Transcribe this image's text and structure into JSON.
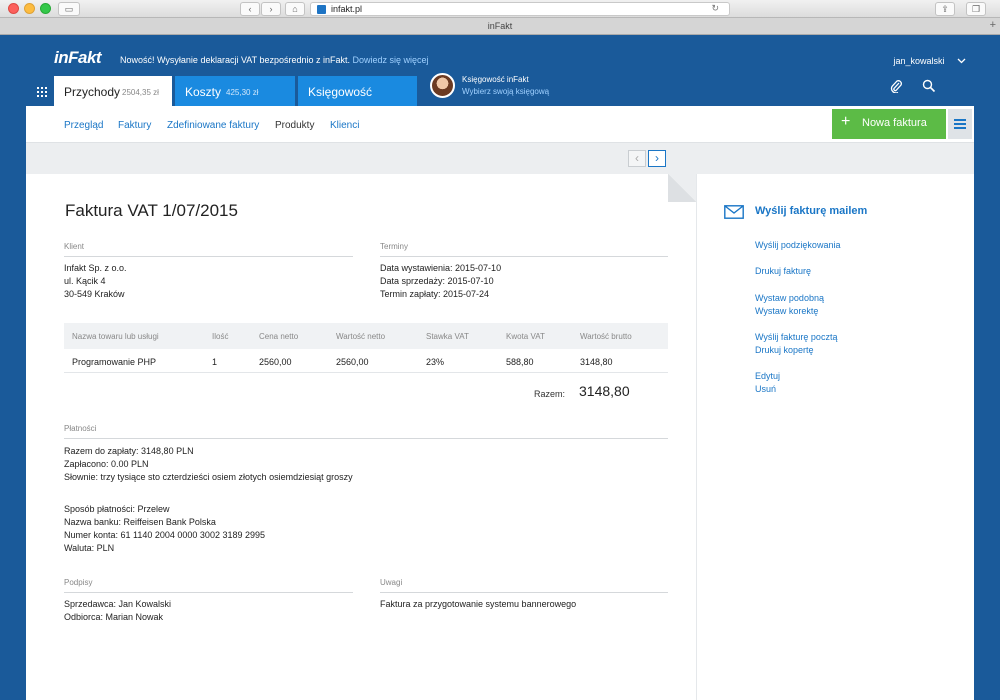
{
  "browser": {
    "url": "infakt.pl",
    "tab_title": "inFakt",
    "new_tab_glyph": "+"
  },
  "header": {
    "logo": "inFakt",
    "news_text": "Nowość! Wysyłanie deklaracji VAT bezpośrednio z inFakt.",
    "news_link": "Dowiedz się więcej",
    "username": "jan_kowalski"
  },
  "tabs": [
    {
      "label": "Przychody",
      "amount": "2504,35 zł"
    },
    {
      "label": "Koszty",
      "amount": "425,30 zł"
    },
    {
      "label": "Księgowość",
      "amount": ""
    }
  ],
  "accountant": {
    "title": "Księgowość inFakt",
    "link": "Wybierz swoją księgową"
  },
  "subnav": {
    "items": [
      "Przegląd",
      "Faktury",
      "Zdefiniowane faktury",
      "Produkty",
      "Klienci"
    ],
    "active_index": 3,
    "new_invoice": "Nowa faktura"
  },
  "invoice": {
    "title": "Faktura VAT 1/07/2015",
    "client_label": "Klient",
    "client_lines": [
      "Infakt Sp. z o.o.",
      "ul. Kącik 4",
      "30-549 Kraków"
    ],
    "terms_label": "Terminy",
    "terms_lines": [
      "Data wystawienia: 2015-07-10",
      "Data sprzedaży: 2015-07-10",
      "Termin zapłaty: 2015-07-24"
    ],
    "table": {
      "headers": [
        "Nazwa towaru lub usługi",
        "Ilość",
        "Cena netto",
        "Wartość netto",
        "Stawka VAT",
        "Kwota VAT",
        "Wartość brutto"
      ],
      "rows": [
        [
          "Programowanie PHP",
          "1",
          "2560,00",
          "2560,00",
          "23%",
          "588,80",
          "3148,80"
        ]
      ]
    },
    "total_label": "Razem:",
    "total_value": "3148,80",
    "payments_label": "Płatności",
    "payments_lines": [
      "Razem do zapłaty: 3148,80 PLN",
      "Zapłacono: 0.00 PLN",
      "Słownie: trzy tysiące sto czterdzieści osiem złotych osiemdziesiąt groszy"
    ],
    "method_lines": [
      "Sposób płatności: Przelew",
      "Nazwa banku: Reiffeisen Bank Polska",
      "Numer konta: 61 1140 2004 0000 3002 3189 2995",
      "Waluta: PLN"
    ],
    "signatures_label": "Podpisy",
    "signatures_lines": [
      "Sprzedawca: Jan Kowalski",
      "Odbiorca: Marian Nowak"
    ],
    "notes_label": "Uwagi",
    "notes_text": "Faktura za przygotowanie systemu bannerowego"
  },
  "sidebar": {
    "mail_title": "Wyślij fakturę mailem",
    "links": [
      "Wyślij podziękowania",
      "Drukuj fakturę",
      "Wystaw podobną",
      "Wystaw korektę",
      "Wyślij fakturę pocztą",
      "Drukuj kopertę",
      "Edytuj",
      "Usuń"
    ]
  },
  "colors": {
    "brand_blue": "#1a5a9a",
    "tab_blue": "#1a8ae0",
    "link_blue": "#1a76c6",
    "green_button": "#5cbb46"
  }
}
